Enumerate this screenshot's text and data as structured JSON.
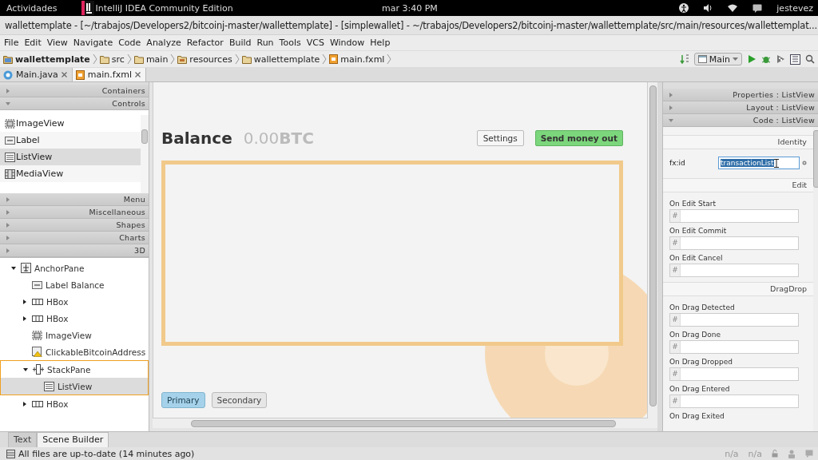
{
  "top_bar": {
    "activities": "Actividades",
    "app": "IntelliJ IDEA Community Edition",
    "clock": "mar  3:40 PM",
    "user": "jestevez"
  },
  "window": {
    "title": "wallettemplate - [~/trabajos/Developers2/bitcoinj-master/wallettemplate] - [simplewallet] - ~/trabajos/Developers2/bitcoinj-master/wallettemplate/src/main/resources/wallettemplat..."
  },
  "menu": [
    "File",
    "Edit",
    "View",
    "Navigate",
    "Code",
    "Analyze",
    "Refactor",
    "Build",
    "Run",
    "Tools",
    "VCS",
    "Window",
    "Help"
  ],
  "breadcrumb": [
    {
      "label": "wallettemplate",
      "kind": "module"
    },
    {
      "label": "src",
      "kind": "folder"
    },
    {
      "label": "main",
      "kind": "folder"
    },
    {
      "label": "resources",
      "kind": "resources"
    },
    {
      "label": "wallettemplate",
      "kind": "folder"
    },
    {
      "label": "main.fxml",
      "kind": "fxml"
    }
  ],
  "run_config": "Main",
  "editor_tabs": [
    {
      "label": "Main.java",
      "kind": "java",
      "selected": false
    },
    {
      "label": "main.fxml",
      "kind": "fxml",
      "selected": true
    }
  ],
  "library": [
    {
      "label": "Containers",
      "expanded": false
    },
    {
      "label": "Controls",
      "expanded": true,
      "items": [
        {
          "label": "ImageView",
          "kind": "image",
          "selected": false
        },
        {
          "label": "Label",
          "kind": "label",
          "selected": false
        },
        {
          "label": "ListView",
          "kind": "list",
          "selected": true
        },
        {
          "label": "MediaView",
          "kind": "media",
          "selected": false
        }
      ]
    },
    {
      "label": "Menu",
      "expanded": false
    },
    {
      "label": "Miscellaneous",
      "expanded": false
    },
    {
      "label": "Shapes",
      "expanded": false
    },
    {
      "label": "Charts",
      "expanded": false
    },
    {
      "label": "3D",
      "expanded": false
    }
  ],
  "hierarchy": [
    {
      "label": "AnchorPane",
      "kind": "anchor",
      "expanded": true,
      "selected": false,
      "highlighted": false,
      "children": [
        {
          "label": "Label Balance",
          "kind": "label",
          "selected": false,
          "highlighted": false
        },
        {
          "label": "HBox",
          "kind": "hbox",
          "expanded": false,
          "selected": false,
          "highlighted": false
        },
        {
          "label": "HBox",
          "kind": "hbox",
          "expanded": false,
          "selected": false,
          "highlighted": false
        },
        {
          "label": "ImageView",
          "kind": "image",
          "selected": false,
          "highlighted": false
        },
        {
          "label": "ClickableBitcoinAddress",
          "kind": "warning",
          "selected": false,
          "highlighted": false
        },
        {
          "label": "StackPane",
          "kind": "stack",
          "expanded": true,
          "selected": false,
          "highlighted": true,
          "children": [
            {
              "label": "ListView",
              "kind": "list",
              "selected": true,
              "highlighted": false
            }
          ]
        },
        {
          "label": "HBox",
          "kind": "hbox",
          "expanded": false,
          "selected": false,
          "highlighted": false
        }
      ]
    }
  ],
  "canvas": {
    "title": "Balance",
    "amount": "0.00",
    "unit": "BTC",
    "buttons": [
      {
        "label": "Settings",
        "kind": "plain"
      },
      {
        "label": "Send money out",
        "kind": "primary"
      }
    ],
    "toggles": [
      {
        "label": "Primary",
        "selected": true
      },
      {
        "label": "Secondary",
        "selected": false
      }
    ]
  },
  "inspector": {
    "sections": [
      {
        "label": "Properties : ListView",
        "expanded": false
      },
      {
        "label": "Layout : ListView",
        "expanded": false
      },
      {
        "label": "Code : ListView",
        "expanded": true
      }
    ],
    "groups": [
      {
        "heading": "Identity",
        "fields": [
          {
            "label": "fx:id",
            "kind": "inline",
            "value": "transactionList"
          }
        ]
      },
      {
        "heading": "Edit",
        "fields": [
          {
            "label": "On Edit Start",
            "kind": "handler",
            "prefix": "#"
          },
          {
            "label": "On Edit Commit",
            "kind": "handler",
            "prefix": "#"
          },
          {
            "label": "On Edit Cancel",
            "kind": "handler",
            "prefix": "#"
          }
        ]
      },
      {
        "heading": "DragDrop",
        "fields": [
          {
            "label": "On Drag Detected",
            "kind": "handler",
            "prefix": "#"
          },
          {
            "label": "On Drag Done",
            "kind": "handler",
            "prefix": "#"
          },
          {
            "label": "On Drag Dropped",
            "kind": "handler",
            "prefix": "#"
          },
          {
            "label": "On Drag Entered",
            "kind": "handler",
            "prefix": "#"
          },
          {
            "label": "On Drag Exited",
            "kind": "label"
          }
        ]
      }
    ]
  },
  "bottom_tabs": [
    {
      "label": "Text",
      "selected": false
    },
    {
      "label": "Scene Builder",
      "selected": true
    }
  ],
  "status": {
    "message": "All files are up-to-date (14 minutes ago)",
    "position": "n/a",
    "encoding": "n/a"
  }
}
